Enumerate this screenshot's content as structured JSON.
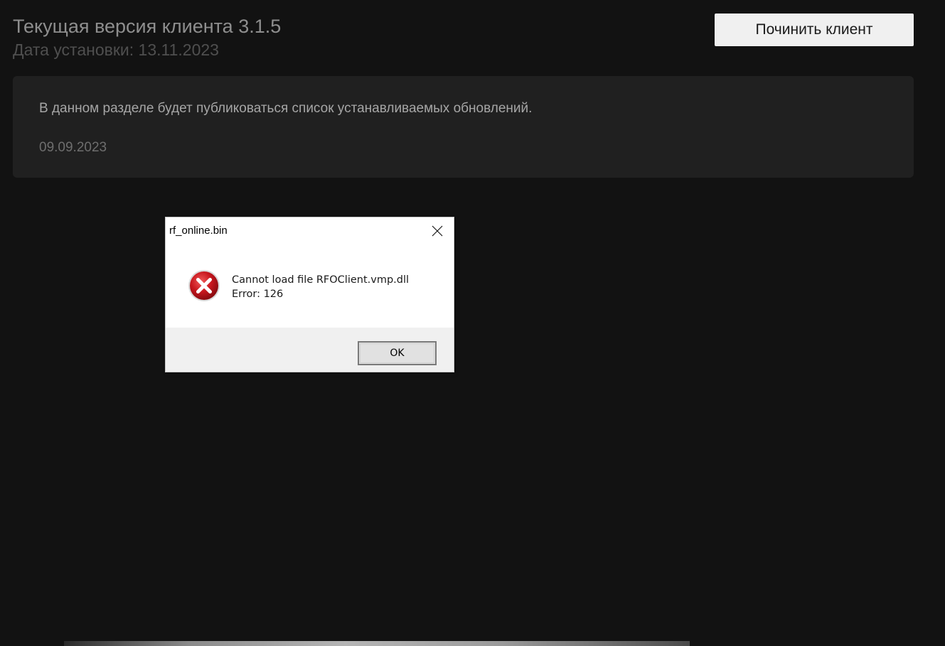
{
  "launcher": {
    "version_title": "Текущая версия клиента 3.1.5",
    "install_date": "Дата установки: 13.11.2023",
    "repair_button_label": "Починить клиент",
    "updates": {
      "text": "В данном разделе будет публиковаться список устанавливаемых обновлений.",
      "date": "09.09.2023"
    }
  },
  "dialog": {
    "title": "rf_online.bin",
    "message_line1": "Cannot load file RFOClient.vmp.dll",
    "message_line2": "Error: 126",
    "ok_label": "OK",
    "icon": "error-icon",
    "close_icon": "close-icon"
  },
  "colors": {
    "background": "#121212",
    "panel": "#202020",
    "error_red": "#c8171e"
  }
}
